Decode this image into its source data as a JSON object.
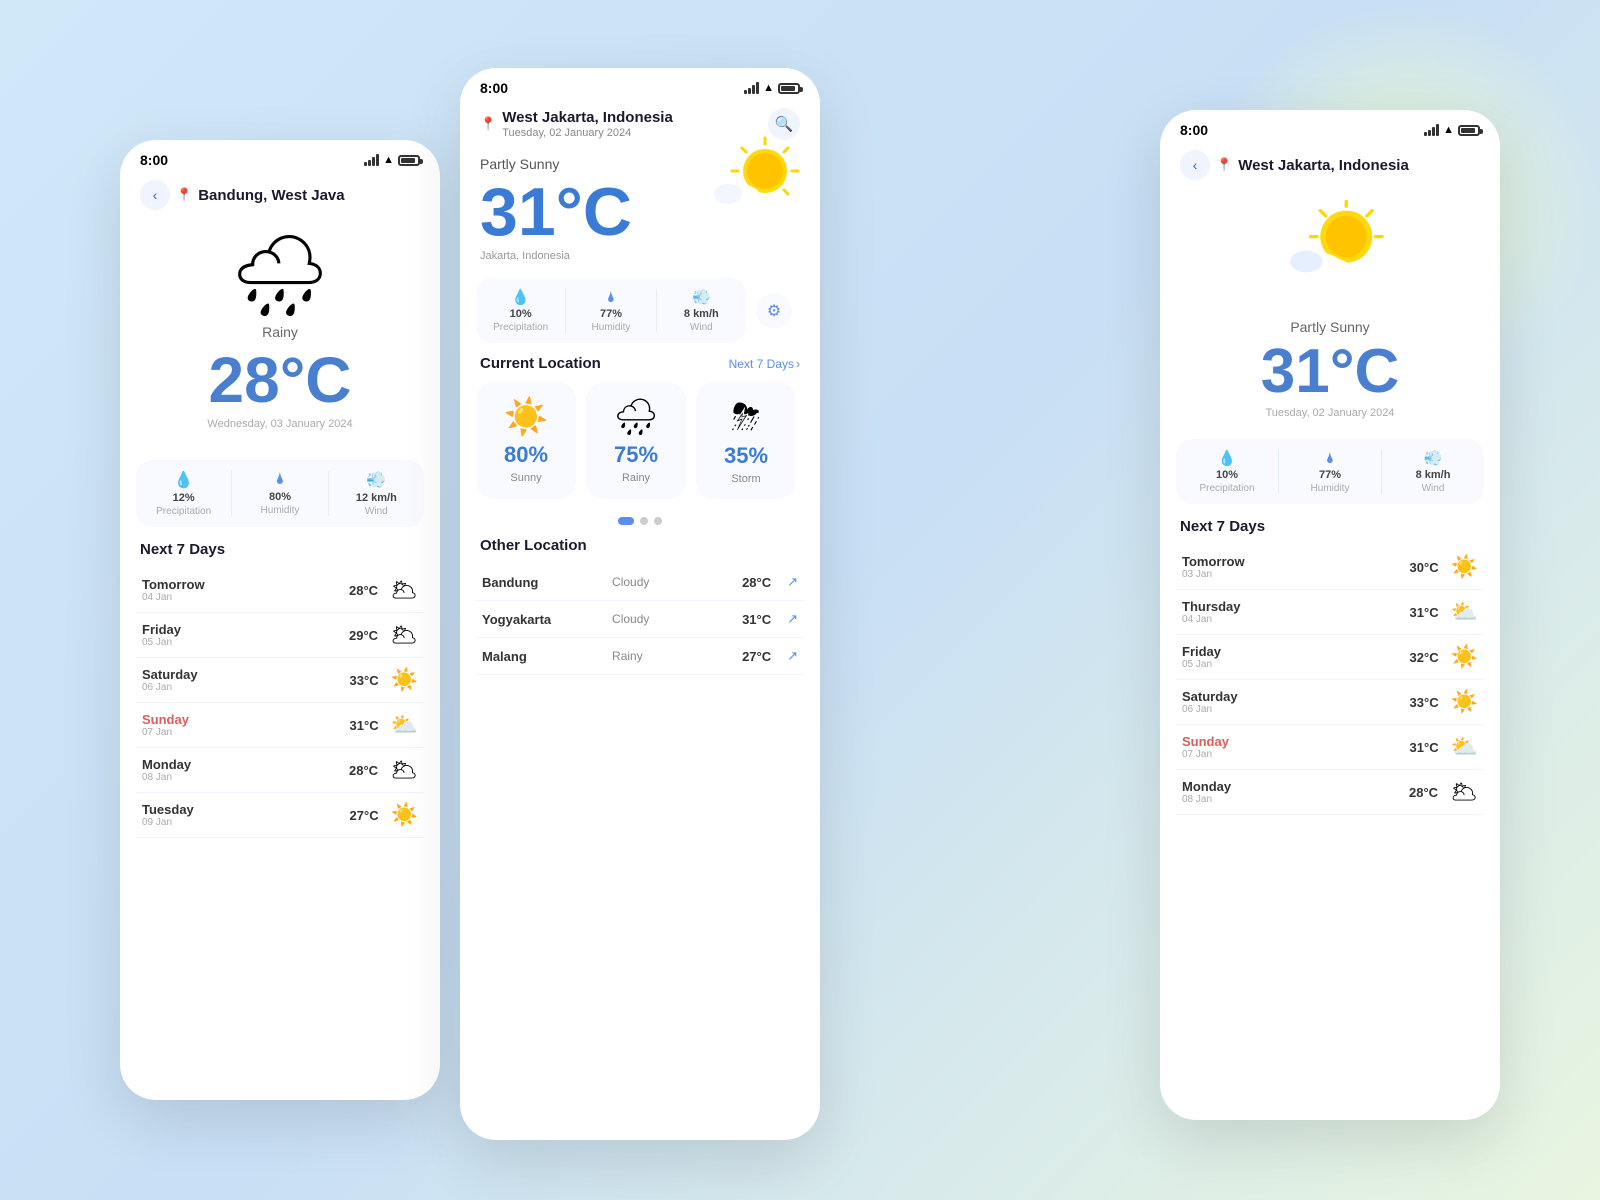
{
  "background": {
    "gradient_start": "#d0e8f8",
    "gradient_end": "#e8f5e0"
  },
  "left_phone": {
    "status": {
      "time": "8:00"
    },
    "header": {
      "back_label": "‹",
      "city": "Bandung, West Java"
    },
    "weather": {
      "condition": "Rainy",
      "temperature": "28°C",
      "date": "Wednesday, 03 January 2024"
    },
    "stats": {
      "precipitation_value": "12%",
      "precipitation_label": "Precipitation",
      "humidity_value": "80%",
      "humidity_label": "Humidity",
      "wind_value": "12 km/h",
      "wind_label": "Wind"
    },
    "next7": {
      "title": "Next 7 Days",
      "days": [
        {
          "name": "Tomorrow",
          "date": "04 Jan",
          "temp": "28°C",
          "icon": "🌥",
          "sunday": false
        },
        {
          "name": "Friday",
          "date": "05 Jan",
          "temp": "29°C",
          "icon": "🌥",
          "sunday": false
        },
        {
          "name": "Saturday",
          "date": "06 Jan",
          "temp": "33°C",
          "icon": "☀️",
          "sunday": false
        },
        {
          "name": "Sunday",
          "date": "07 Jan",
          "temp": "31°C",
          "icon": "⛅",
          "sunday": true
        },
        {
          "name": "Monday",
          "date": "08 Jan",
          "temp": "28°C",
          "icon": "🌥",
          "sunday": false
        },
        {
          "name": "Tuesday",
          "date": "09 Jan",
          "temp": "27°C",
          "icon": "☀️",
          "sunday": false
        }
      ]
    }
  },
  "center_phone": {
    "status": {
      "time": "8:00"
    },
    "header": {
      "city": "West Jakarta, Indonesia",
      "date": "Tuesday, 02 January 2024",
      "search_label": "🔍"
    },
    "weather": {
      "condition": "Partly Sunny",
      "temperature": "31°C",
      "location_sub": "Jakarta, Indonesia"
    },
    "stats": {
      "precipitation_value": "10%",
      "precipitation_label": "Precipitation",
      "humidity_value": "77%",
      "humidity_label": "Humidity",
      "wind_value": "8 km/h",
      "wind_label": "Wind",
      "gear_label": "⚙"
    },
    "current_location": {
      "title": "Current Location",
      "next_link": "Next 7 Days"
    },
    "forecast_cards": [
      {
        "pct": "80%",
        "label": "Sunny",
        "icon": "☀️"
      },
      {
        "pct": "75%",
        "label": "Rainy",
        "icon": "🌧"
      },
      {
        "pct": "35%",
        "label": "Storm",
        "icon": "⛈"
      }
    ],
    "other_locations": {
      "title": "Other Location",
      "locations": [
        {
          "city": "Bandung",
          "condition": "Cloudy",
          "temp": "28°C"
        },
        {
          "city": "Yogyakarta",
          "condition": "Cloudy",
          "temp": "31°C"
        },
        {
          "city": "Malang",
          "condition": "Rainy",
          "temp": "27°C"
        }
      ]
    }
  },
  "right_phone": {
    "status": {
      "time": "8:00"
    },
    "header": {
      "back_label": "‹",
      "city": "West Jakarta, Indonesia"
    },
    "weather": {
      "condition": "Partly Sunny",
      "temperature": "31°C",
      "date": "Tuesday, 02 January 2024"
    },
    "stats": {
      "precipitation_value": "10%",
      "precipitation_label": "Precipitation",
      "humidity_value": "77%",
      "humidity_label": "Humidity",
      "wind_value": "8 km/h",
      "wind_label": "Wind"
    },
    "next7": {
      "title": "Next 7 Days",
      "days": [
        {
          "name": "Tomorrow",
          "date": "03 Jan",
          "temp": "30°C",
          "icon": "☀️",
          "sunday": false
        },
        {
          "name": "Thursday",
          "date": "04 Jan",
          "temp": "31°C",
          "icon": "⛅",
          "sunday": false
        },
        {
          "name": "Friday",
          "date": "05 Jan",
          "temp": "32°C",
          "icon": "☀️",
          "sunday": false
        },
        {
          "name": "Saturday",
          "date": "06 Jan",
          "temp": "33°C",
          "icon": "☀️",
          "sunday": false
        },
        {
          "name": "Sunday",
          "date": "07 Jan",
          "temp": "31°C",
          "icon": "⛅",
          "sunday": true
        },
        {
          "name": "Monday",
          "date": "08 Jan",
          "temp": "28°C",
          "icon": "🌥",
          "sunday": false
        }
      ]
    }
  }
}
